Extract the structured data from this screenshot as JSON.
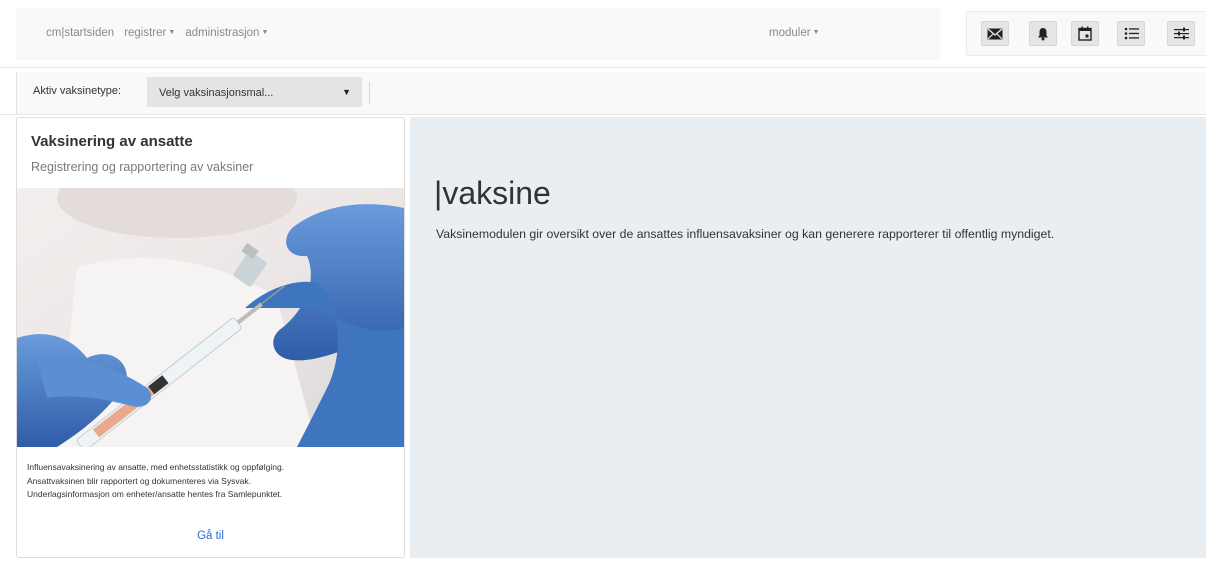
{
  "nav": {
    "home": "cm|startsiden",
    "registrer": "registrer",
    "administrasjon": "administrasjon",
    "moduler": "moduler",
    "caret": "▼"
  },
  "toolbar": {
    "icons": [
      "envelope-icon",
      "bell-icon",
      "calendar-icon",
      "list-icon",
      "sliders-icon"
    ]
  },
  "filter": {
    "label": "Aktiv vaksinetype:",
    "select_value": "Velg vaksinasjonsmal...",
    "arrow": "▼"
  },
  "card": {
    "title": "Vaksinering av ansatte",
    "subtitle": "Registrering og rapportering av vaksiner",
    "description": [
      "Influensavaksinering av ansatte, med enhetsstatistikk og oppfølging.",
      "Ansattvaksinen blir rapportert og dokumenteres via Sysvak.",
      "Underlagsinformasjon om enheter/ansatte hentes fra Samlepunktet."
    ],
    "link": "Gå til"
  },
  "module": {
    "title": "|vaksine",
    "description": "Vaksinemodulen gir oversikt over de ansattes influensavaksiner og kan generere rapporterer til offentlig myndiget."
  },
  "colors": {
    "link": "#2f6bd0",
    "panel_bg": "#e9eef2",
    "glove": "#4a7fc6"
  }
}
